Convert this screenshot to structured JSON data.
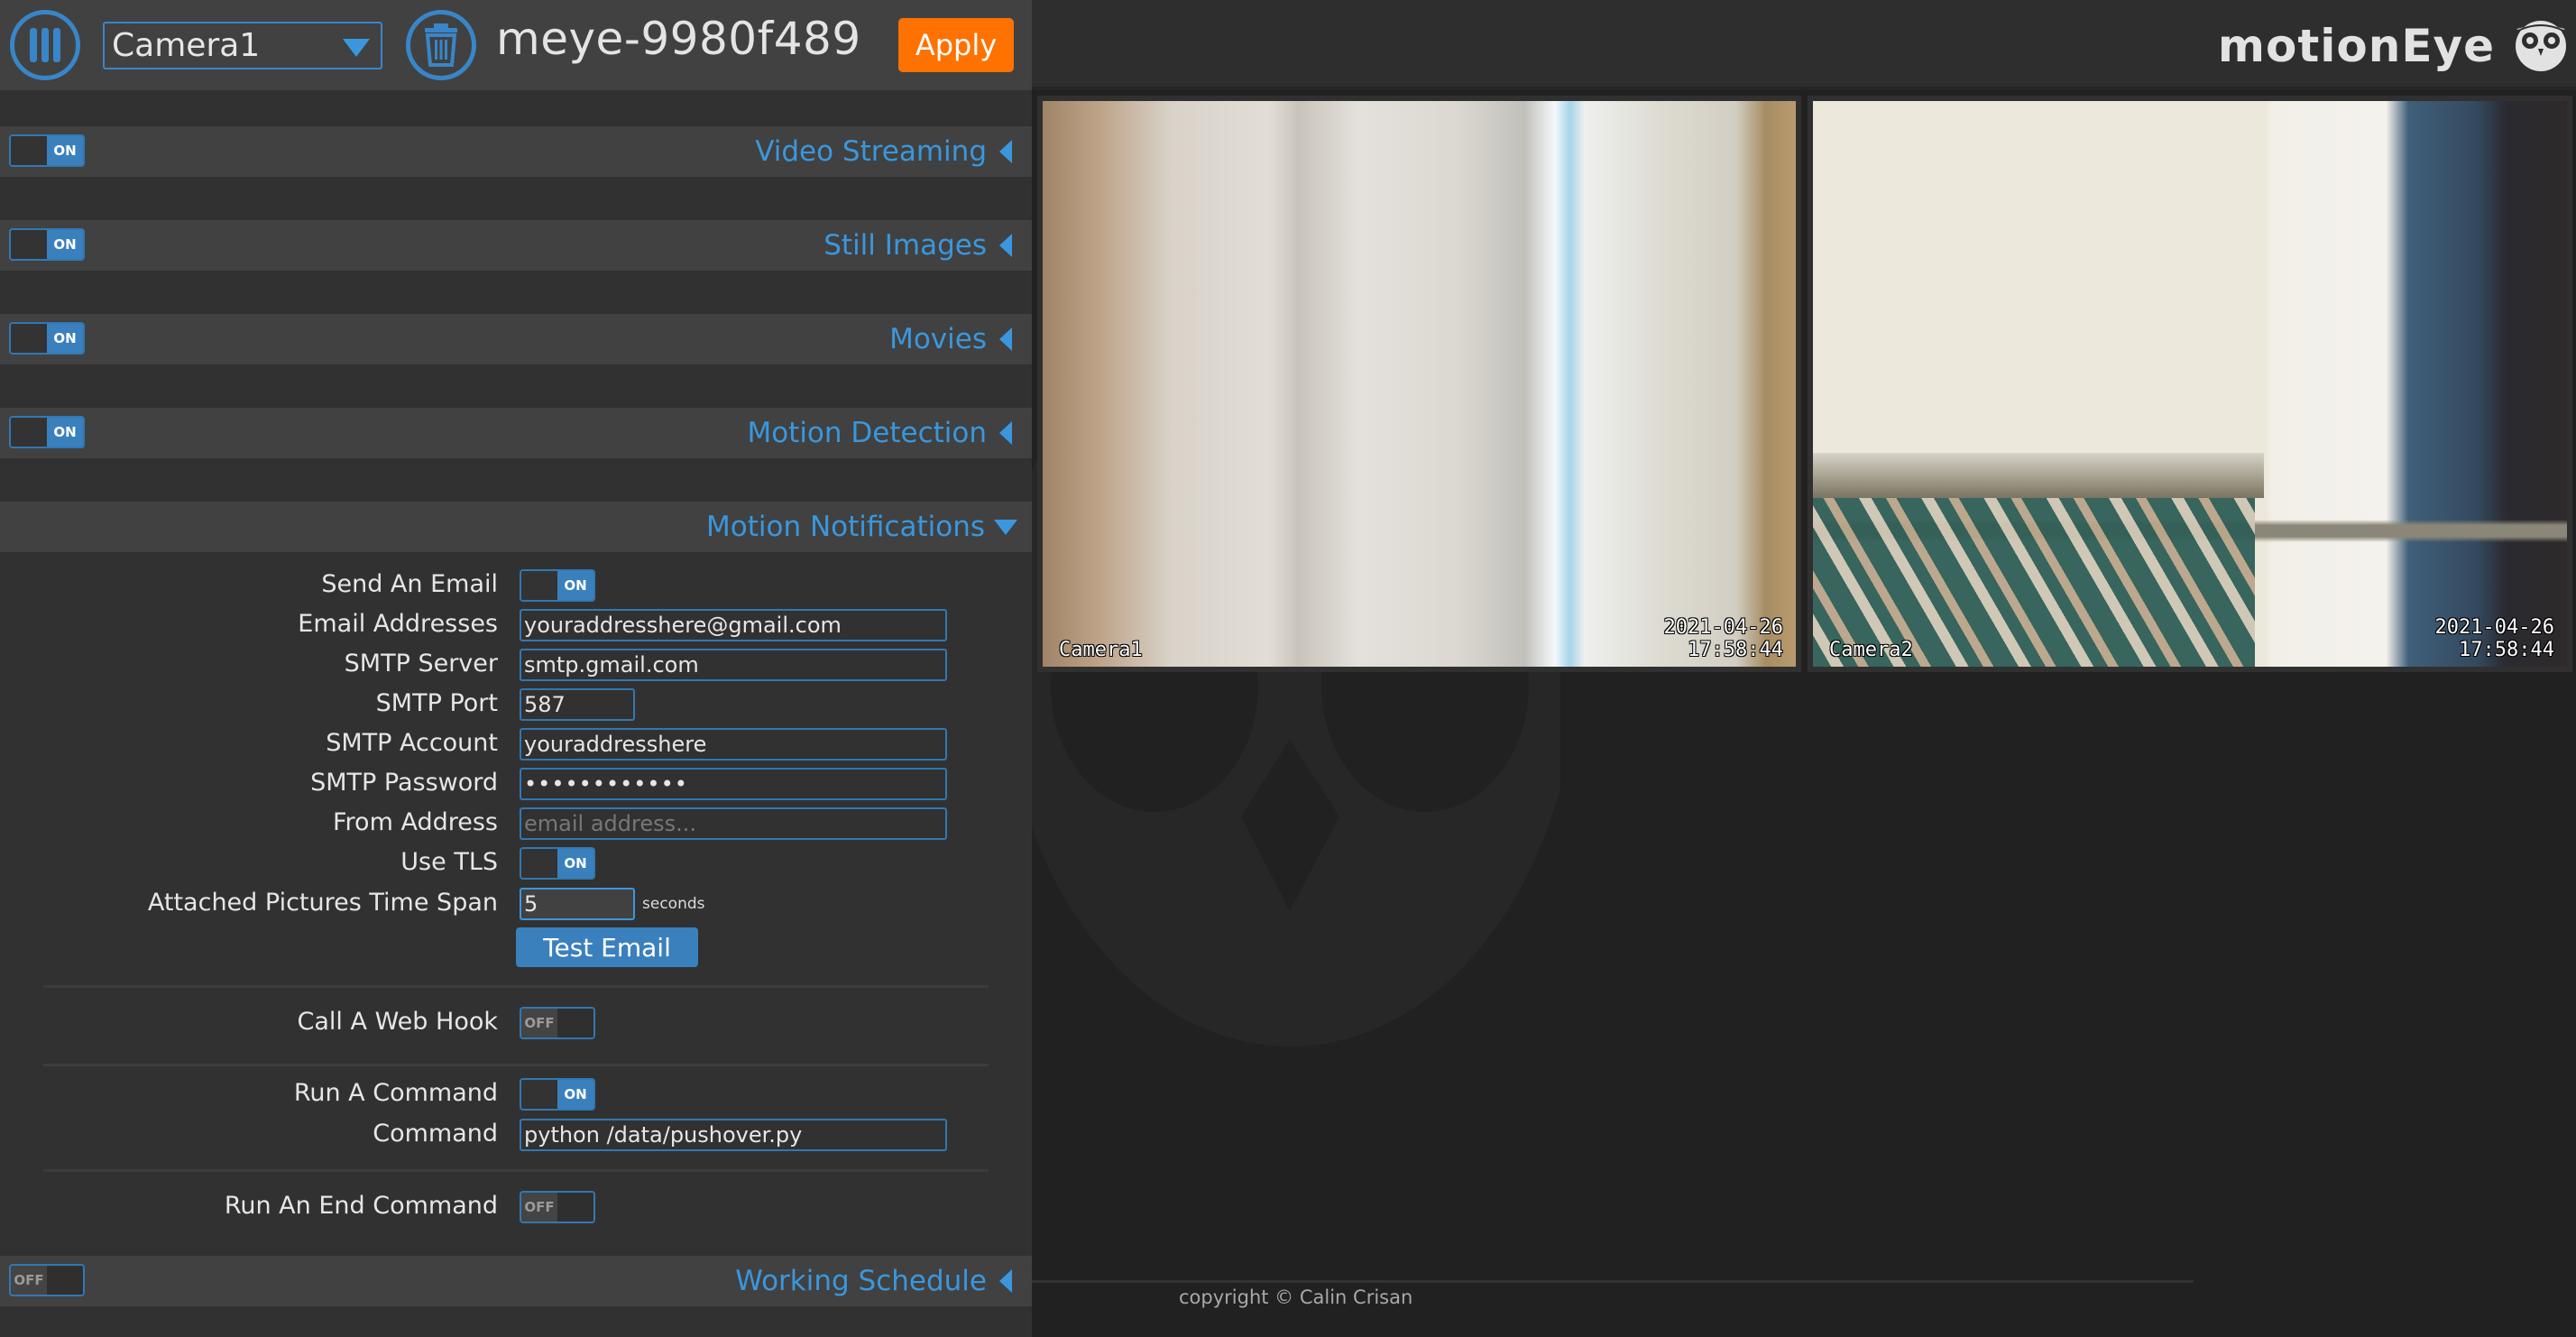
{
  "header": {
    "menu_icon": "menu-bars-icon",
    "camera_select": {
      "value": "Camera1",
      "icon": "chevron-down-icon"
    },
    "remove_icon": "trash-icon",
    "camera_title": "meye-9980f489",
    "apply_label": "Apply",
    "brand": "motionEye",
    "brand_logo": "owl-icon"
  },
  "colors": {
    "accent": "#3a97dd",
    "apply": "#ff7200",
    "toggle_on": "#3a80bd",
    "sidebar_bg": "#313131",
    "section_bg": "#414141",
    "main_bg": "#212121"
  },
  "sections": [
    {
      "title": "Video Streaming",
      "toggle": "ON",
      "expanded": false
    },
    {
      "title": "Still Images",
      "toggle": "ON",
      "expanded": false
    },
    {
      "title": "Movies",
      "toggle": "ON",
      "expanded": false
    },
    {
      "title": "Motion Detection",
      "toggle": "ON",
      "expanded": false
    },
    {
      "title": "Motion Notifications",
      "toggle": null,
      "expanded": true
    },
    {
      "title": "Working Schedule",
      "toggle": "OFF",
      "expanded": false
    }
  ],
  "notifications": {
    "send_email": {
      "label": "Send An Email",
      "toggle": "ON"
    },
    "email_addresses": {
      "label": "Email Addresses",
      "value": "youraddresshere@gmail.com"
    },
    "smtp_server": {
      "label": "SMTP Server",
      "value": "smtp.gmail.com"
    },
    "smtp_port": {
      "label": "SMTP Port",
      "value": "587"
    },
    "smtp_account": {
      "label": "SMTP Account",
      "value": "youraddresshere"
    },
    "smtp_password": {
      "label": "SMTP Password",
      "value": "••••••••••••"
    },
    "from_address": {
      "label": "From Address",
      "value": "",
      "placeholder": "email address..."
    },
    "use_tls": {
      "label": "Use TLS",
      "toggle": "ON"
    },
    "time_span": {
      "label": "Attached Pictures Time Span",
      "value": "5",
      "unit": "seconds"
    },
    "test_email_label": "Test Email",
    "web_hook": {
      "label": "Call A Web Hook",
      "toggle": "OFF"
    },
    "run_command": {
      "label": "Run A Command",
      "toggle": "ON"
    },
    "command": {
      "label": "Command",
      "value": "python /data/pushover.py"
    },
    "end_command": {
      "label": "Run An End Command",
      "toggle": "OFF"
    }
  },
  "cameras": [
    {
      "name": "Camera1",
      "date": "2021-04-26",
      "time": "17:58:44"
    },
    {
      "name": "Camera2",
      "date": "2021-04-26",
      "time": "17:58:44"
    }
  ],
  "footer": {
    "copyright": "copyright © Calin Crisan"
  }
}
